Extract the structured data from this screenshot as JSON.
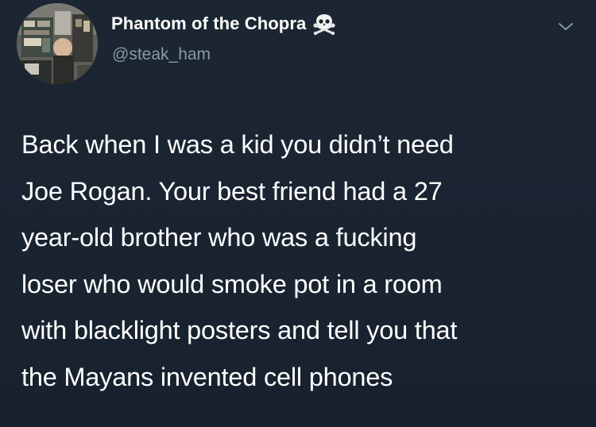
{
  "tweet": {
    "display_name": "Phantom of the Chopra",
    "name_emoji_icon": "skull-crossbones-icon",
    "handle": "@steak_ham",
    "caret_icon": "chevron-down-icon",
    "text_lines": [
      "Back when I was a kid you didn’t need",
      "Joe Rogan. Your best friend had a 27",
      "year-old brother who was a fucking",
      "loser who would smoke pot in a room",
      "with blacklight posters and tell you that",
      "the Mayans invented cell phones"
    ]
  },
  "colors": {
    "background": "#1b2532",
    "text": "#ffffff",
    "handle": "#8a98a6",
    "caret": "#8a98a6"
  }
}
